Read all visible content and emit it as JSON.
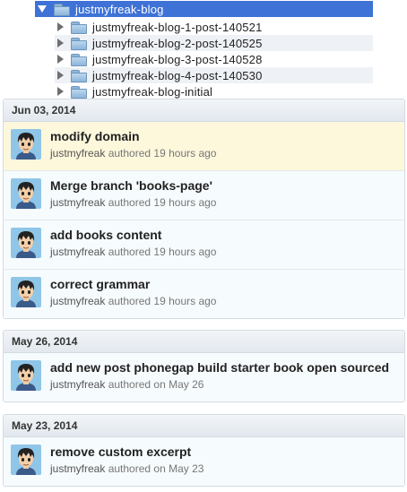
{
  "tree": {
    "root": {
      "label": "justmyfreak-blog",
      "icon": "folder-icon"
    },
    "children": [
      {
        "label": "justmyfreak-blog-1-post-140521"
      },
      {
        "label": "justmyfreak-blog-2-post-140525"
      },
      {
        "label": "justmyfreak-blog-3-post-140528"
      },
      {
        "label": "justmyfreak-blog-4-post-140530"
      },
      {
        "label": "justmyfreak-blog-initial"
      }
    ]
  },
  "groups": [
    {
      "date": "Jun 03, 2014",
      "commits": [
        {
          "title": "modify domain",
          "author": "justmyfreak",
          "authored_text": "authored 19 hours ago"
        },
        {
          "title": "Merge branch 'books-page'",
          "author": "justmyfreak",
          "authored_text": "authored 19 hours ago"
        },
        {
          "title": "add books content",
          "author": "justmyfreak",
          "authored_text": "authored 19 hours ago"
        },
        {
          "title": "correct grammar",
          "author": "justmyfreak",
          "authored_text": "authored 19 hours ago"
        }
      ]
    },
    {
      "date": "May 26, 2014",
      "commits": [
        {
          "title": "add new post phonegap build starter book open sourced",
          "author": "justmyfreak",
          "authored_text": "authored on May 26"
        }
      ]
    },
    {
      "date": "May 23, 2014",
      "commits": [
        {
          "title": "remove custom excerpt",
          "author": "justmyfreak",
          "authored_text": "authored on May 23"
        }
      ]
    }
  ],
  "colors": {
    "selection": "#3e72d6",
    "highlight_row": "#fdf8dc",
    "commit_row": "#f6fbfd"
  }
}
